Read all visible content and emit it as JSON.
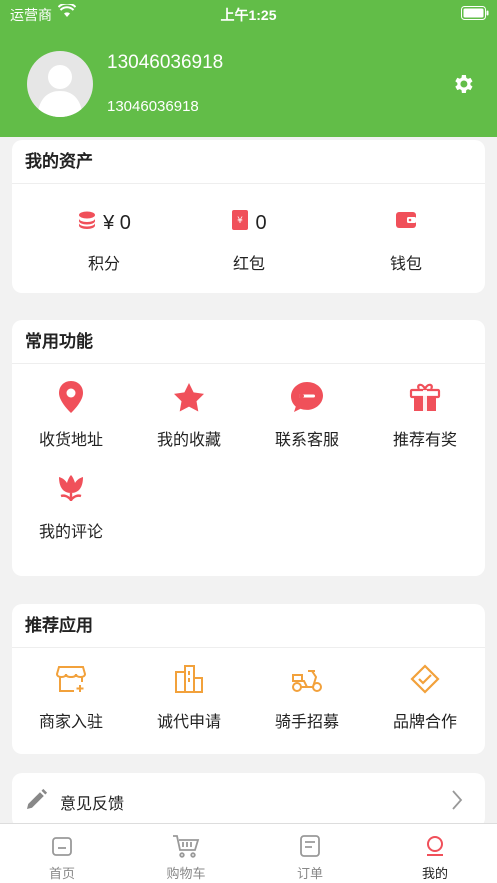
{
  "status_bar": {
    "carrier": "运营商",
    "time": "上午1:25"
  },
  "profile": {
    "name": "13046036918",
    "phone": "13046036918"
  },
  "assets": {
    "title": "我的资产",
    "items": [
      {
        "value": "¥ 0",
        "label": "积分",
        "icon": "coins-icon"
      },
      {
        "value": "0",
        "label": "红包",
        "icon": "red-packet-icon"
      },
      {
        "value": "",
        "label": "钱包",
        "icon": "wallet-icon"
      }
    ]
  },
  "common": {
    "title": "常用功能",
    "items": [
      {
        "label": "收货地址",
        "icon": "location-pin-icon"
      },
      {
        "label": "我的收藏",
        "icon": "star-icon"
      },
      {
        "label": "联系客服",
        "icon": "chat-icon"
      },
      {
        "label": "推荐有奖",
        "icon": "gift-icon"
      },
      {
        "label": "我的评论",
        "icon": "tulip-icon"
      }
    ]
  },
  "recommend": {
    "title": "推荐应用",
    "items": [
      {
        "label": "商家入驻",
        "icon": "shop-icon"
      },
      {
        "label": "诚代申请",
        "icon": "building-icon"
      },
      {
        "label": "骑手招募",
        "icon": "scooter-icon"
      },
      {
        "label": "品牌合作",
        "icon": "handshake-icon"
      }
    ]
  },
  "feedback": {
    "label": "意见反馈"
  },
  "tabbar": {
    "items": [
      {
        "label": "首页",
        "icon": "home-icon"
      },
      {
        "label": "购物车",
        "icon": "cart-icon"
      },
      {
        "label": "订单",
        "icon": "order-icon"
      },
      {
        "label": "我的",
        "icon": "profile-icon"
      }
    ],
    "active_index": 3
  },
  "colors": {
    "brand_green": "#62bd48",
    "accent_red": "#f0505a",
    "accent_orange": "#f2a13b"
  }
}
